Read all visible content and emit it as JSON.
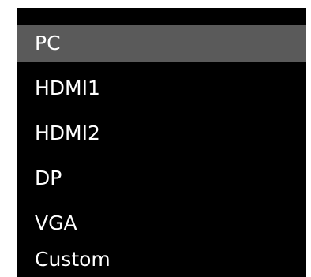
{
  "menu": {
    "selected_index": 0,
    "colors": {
      "background": "#000000",
      "selected_background": "#5a5a5a",
      "text": "#ffffff"
    },
    "items": [
      {
        "label": "PC"
      },
      {
        "label": "HDMI1"
      },
      {
        "label": "HDMI2"
      },
      {
        "label": "DP"
      },
      {
        "label": "VGA"
      },
      {
        "label": "Custom"
      }
    ]
  }
}
